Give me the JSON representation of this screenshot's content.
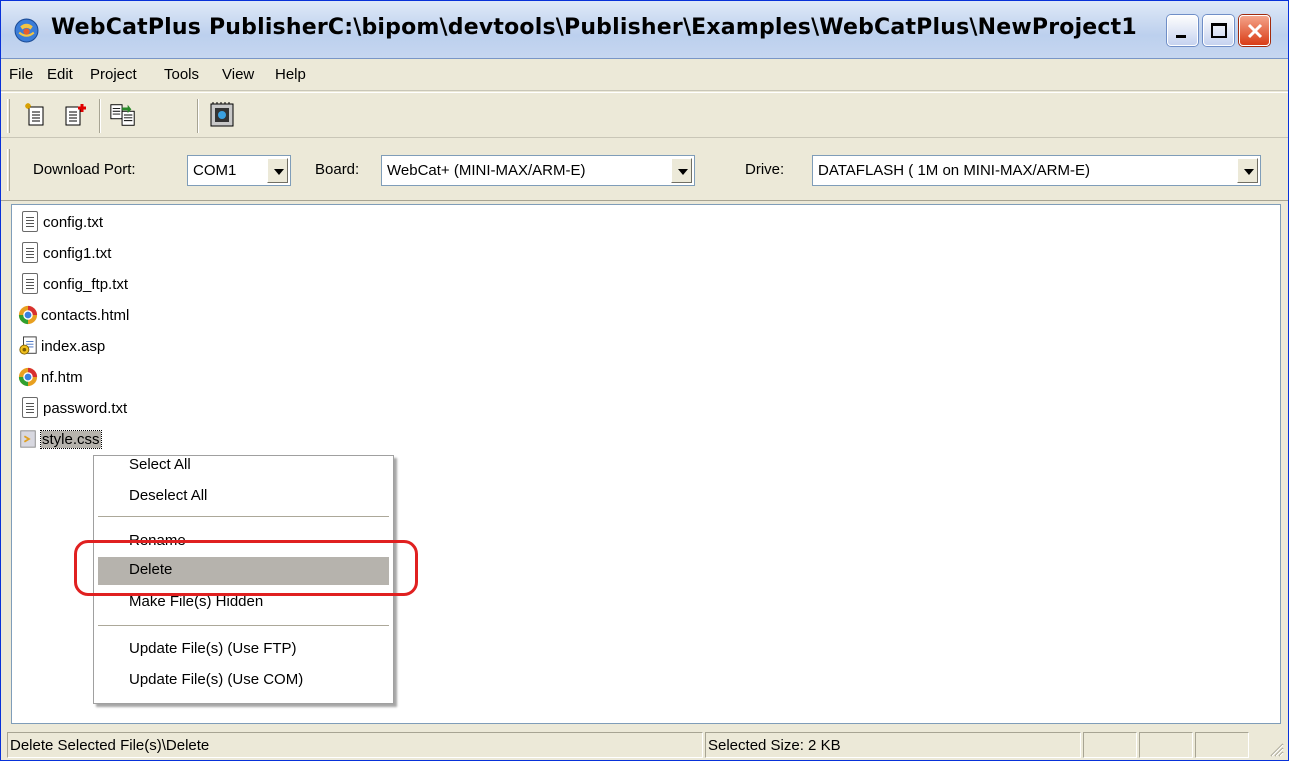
{
  "window": {
    "title": "WebCatPlus PublisherC:\\bipom\\devtools\\Publisher\\Examples\\WebCatPlus\\NewProject1"
  },
  "menu": {
    "items": [
      "File",
      "Edit",
      "Project",
      "Tools",
      "View",
      "Help"
    ]
  },
  "toolbar": {
    "buttons": [
      "new-project-icon",
      "new-file-icon",
      "copy-files-icon",
      "board-icon"
    ]
  },
  "settings": {
    "download_port_label": "Download Port:",
    "download_port_value": "COM1",
    "board_label": "Board:",
    "board_value": "WebCat+ (MINI-MAX/ARM-E)",
    "drive_label": "Drive:",
    "drive_value": "DATAFLASH ( 1M on  MINI-MAX/ARM-E)"
  },
  "files": [
    {
      "name": "config.txt",
      "icon": "text-file-icon"
    },
    {
      "name": "config1.txt",
      "icon": "text-file-icon"
    },
    {
      "name": "config_ftp.txt",
      "icon": "text-file-icon"
    },
    {
      "name": "contacts.html",
      "icon": "browser-icon"
    },
    {
      "name": "index.asp",
      "icon": "asp-file-icon"
    },
    {
      "name": "nf.htm",
      "icon": "browser-icon"
    },
    {
      "name": "password.txt",
      "icon": "text-file-icon"
    },
    {
      "name": "style.css",
      "icon": "css-file-icon",
      "selected": true
    }
  ],
  "context_menu": {
    "items": [
      {
        "label": "Select All"
      },
      {
        "label": "Deselect All"
      },
      {
        "label": "Rename"
      },
      {
        "label": "Delete",
        "highlighted": true
      },
      {
        "label": "Make File(s) Hidden"
      },
      {
        "label": "Update File(s) (Use FTP)"
      },
      {
        "label": "Update File(s) (Use COM)"
      }
    ]
  },
  "status": {
    "message": "Delete Selected File(s)\\Delete",
    "selected_size": "Selected Size: 2 KB"
  },
  "colors": {
    "annotation": "#e02020",
    "highlight": "#b6b3ad"
  }
}
